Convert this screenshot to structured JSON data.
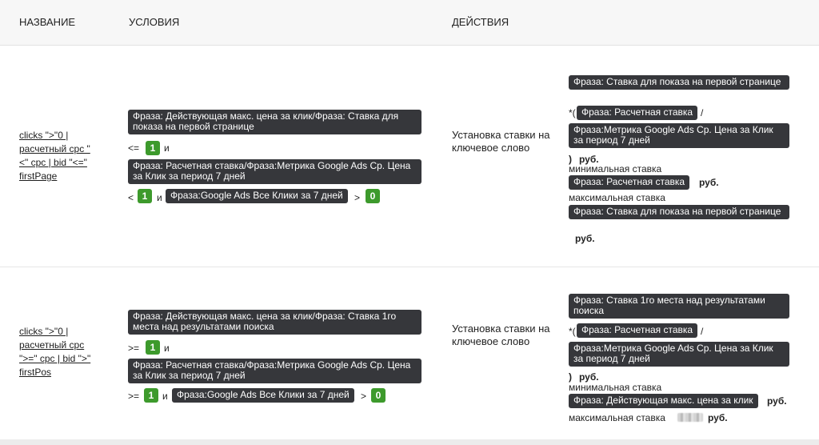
{
  "header": {
    "name_col": "НАЗВАНИЕ",
    "conditions_col": "УСЛОВИЯ",
    "actions_col": "ДЕЙСТВИЯ"
  },
  "rules": [
    {
      "name_lines": [
        "clicks \">\"0 |",
        "расчетный cpc \"",
        "<\" cpc | bid \"<=\"",
        "firstPage"
      ],
      "conditions": {
        "metric1": "Фраза: Действующая макс. цена за клик/Фраза: Ставка для показа на первой странице",
        "op1": "<=",
        "val1": "1",
        "and1": "и",
        "metric2": "Фраза: Расчетная ставка/Фраза:Метрика Google Ads Ср. Цена за Клик за период 7 дней",
        "op2": "<",
        "val2": "1",
        "and2": "и",
        "metric3": "Фраза:Google Ads Все Клики за 7 дней",
        "op3": ">",
        "val3": "0"
      },
      "action": "Установка ставки на ключевое слово",
      "formula": {
        "base": "Фраза: Ставка для показа на первой странице",
        "mul_open": "*(",
        "factor": "Фраза: Расчетная ставка",
        "div": "/",
        "divisor": "Фраза:Метрика Google Ads Ср. Цена за Клик за период 7 дней",
        "close": ")",
        "currency": "руб.",
        "min_label": "минимальная ставка",
        "min_value": "Фраза: Расчетная ставка",
        "max_label": "максимальная ставка",
        "max_value": "Фраза: Ставка для показа на первой странице"
      }
    },
    {
      "name_lines": [
        "clicks \">\"0 |",
        "расчетный cpc",
        "\">=\" cpc | bid \">\"",
        "firstPos"
      ],
      "conditions": {
        "metric1": "Фраза: Действующая макс. цена за клик/Фраза: Ставка 1го места над результатами поиска",
        "op1": ">=",
        "val1": "1",
        "and1": "и",
        "metric2": "Фраза: Расчетная ставка/Фраза:Метрика Google Ads Ср. Цена за Клик за период 7 дней",
        "op2": ">=",
        "val2": "1",
        "and2": "и",
        "metric3": "Фраза:Google Ads Все Клики за 7 дней",
        "op3": ">",
        "val3": "0"
      },
      "action": "Установка ставки на ключевое слово",
      "formula": {
        "base": "Фраза: Ставка 1го места над результатами поиска",
        "mul_open": "*(",
        "factor": "Фраза: Расчетная ставка",
        "div": "/",
        "divisor": "Фраза:Метрика Google Ads Ср. Цена за Клик за период 7 дней",
        "close": ")",
        "currency": "руб.",
        "min_label": "минимальная ставка",
        "min_value": "Фраза: Действующая макс. цена за клик",
        "max_label": "максимальная ставка"
      }
    }
  ]
}
